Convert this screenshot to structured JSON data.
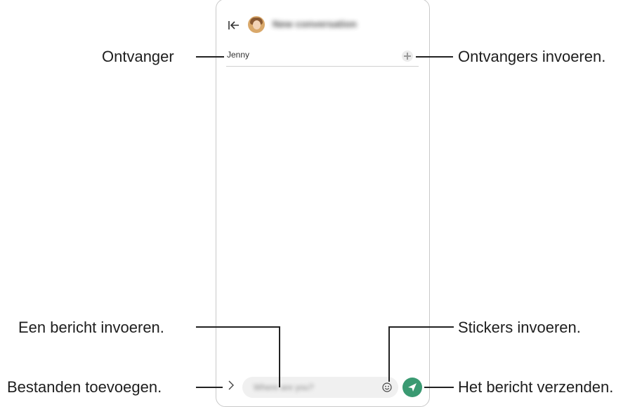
{
  "conversation": {
    "title": "New conversation",
    "recipient": "Jenny",
    "message_placeholder": "Where are you?"
  },
  "callouts": {
    "recipient": "Ontvanger",
    "add_recipients": "Ontvangers invoeren.",
    "enter_message": "Een bericht invoeren.",
    "add_files": "Bestanden toevoegen.",
    "stickers": "Stickers invoeren.",
    "send": "Het bericht verzenden."
  },
  "colors": {
    "send_button": "#3a9a72",
    "input_background": "#f0f0f0"
  }
}
